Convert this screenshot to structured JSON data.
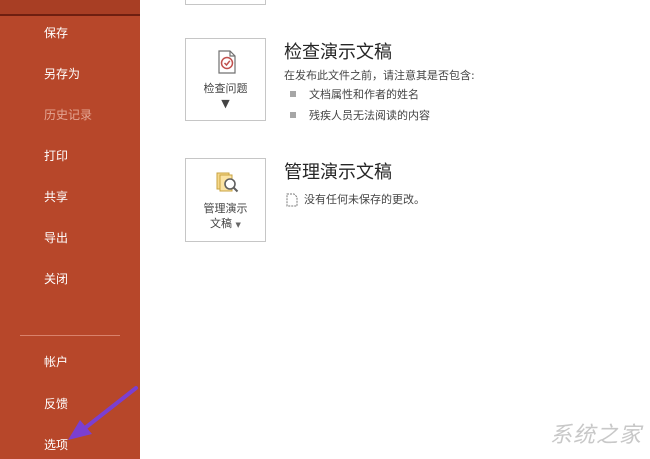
{
  "sidebar": {
    "items": [
      {
        "label": "保存",
        "disabled": false
      },
      {
        "label": "另存为",
        "disabled": false
      },
      {
        "label": "历史记录",
        "disabled": true
      },
      {
        "label": "打印",
        "disabled": false
      },
      {
        "label": "共享",
        "disabled": false
      },
      {
        "label": "导出",
        "disabled": false
      },
      {
        "label": "关闭",
        "disabled": false
      }
    ],
    "bottom_items": [
      {
        "label": "帐户"
      },
      {
        "label": "反馈"
      },
      {
        "label": "选项"
      }
    ],
    "background_color": "#b7472a"
  },
  "inspect": {
    "button_label": "检查问题",
    "title": "检查演示文稿",
    "description": "在发布此文件之前，请注意其是否包含:",
    "bullets": [
      "文档属性和作者的姓名",
      "残疾人员无法阅读的内容"
    ]
  },
  "manage": {
    "button_label_line1": "管理演示",
    "button_label_line2": "文稿",
    "title": "管理演示文稿",
    "status": "没有任何未保存的更改。"
  },
  "annotation": {
    "arrow_color": "#7b3fd0"
  },
  "watermark": {
    "text": "系统之家"
  }
}
